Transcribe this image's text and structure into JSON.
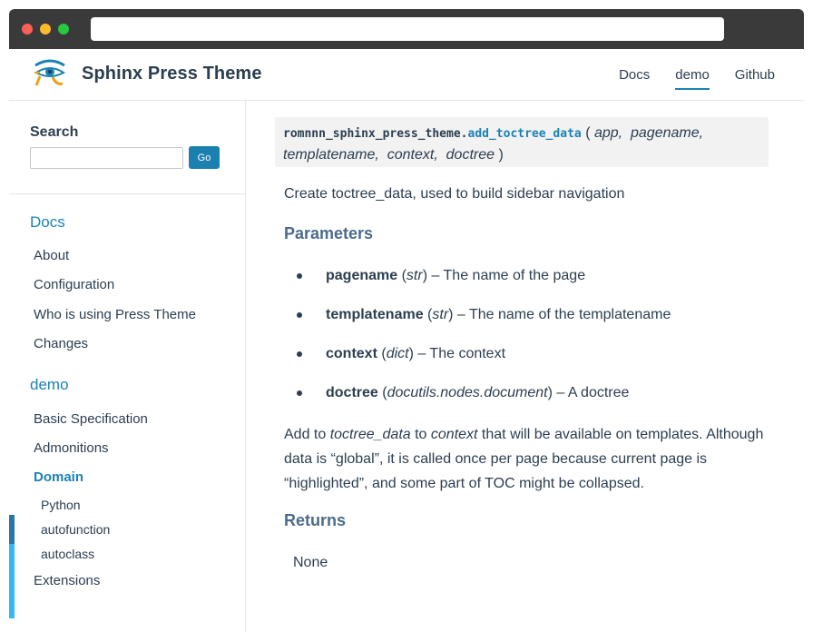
{
  "site": {
    "title": "Sphinx Press Theme",
    "nav": [
      {
        "label": "Docs",
        "active": false
      },
      {
        "label": "demo",
        "active": true
      },
      {
        "label": "Github",
        "active": false
      }
    ]
  },
  "search": {
    "title": "Search",
    "input_value": "",
    "button_label": "Go"
  },
  "sidebar": {
    "docs_title": "Docs",
    "docs_items": [
      "About",
      "Configuration",
      "Who is using Press Theme",
      "Changes"
    ],
    "demo_title": "demo",
    "demo_items": [
      "Basic Specification",
      "Admonitions",
      "Domain"
    ],
    "domain_subitems": [
      "Python",
      "autofunction",
      "autoclass"
    ],
    "after_items": [
      "Extensions"
    ]
  },
  "content": {
    "signature": {
      "module": "romnnn_sphinx_press_theme.",
      "function": "add_toctree_data",
      "open": "(",
      "params": [
        "app,",
        "pagename,",
        "templatename,",
        "context,",
        "doctree"
      ],
      "close": ")"
    },
    "description": "Create toctree_data, used to build sidebar navigation",
    "parameters_heading": "Parameters",
    "parameters": [
      {
        "name": "pagename",
        "type": "str",
        "desc": "The name of the page"
      },
      {
        "name": "templatename",
        "type": "str",
        "desc": "The name of the templatename"
      },
      {
        "name": "context",
        "type": "dict",
        "desc": "The context"
      },
      {
        "name": "doctree",
        "type": "docutils.nodes.document",
        "desc": "A doctree"
      }
    ],
    "paragraph": {
      "t1": "Add to ",
      "t2": "toctree_data",
      "t3": " to ",
      "t4": "context",
      "t5": " that will be available on templates. Although data is “global”, it is called once per page because current page is “highlighted”, and some part of TOC might be collapsed."
    },
    "returns_heading": "Returns",
    "returns_value": "None"
  },
  "colors": {
    "accent": "#1b82b6",
    "heading": "#4c6b8c",
    "text": "#2c3e50",
    "go_button": "#1b7fb0"
  }
}
